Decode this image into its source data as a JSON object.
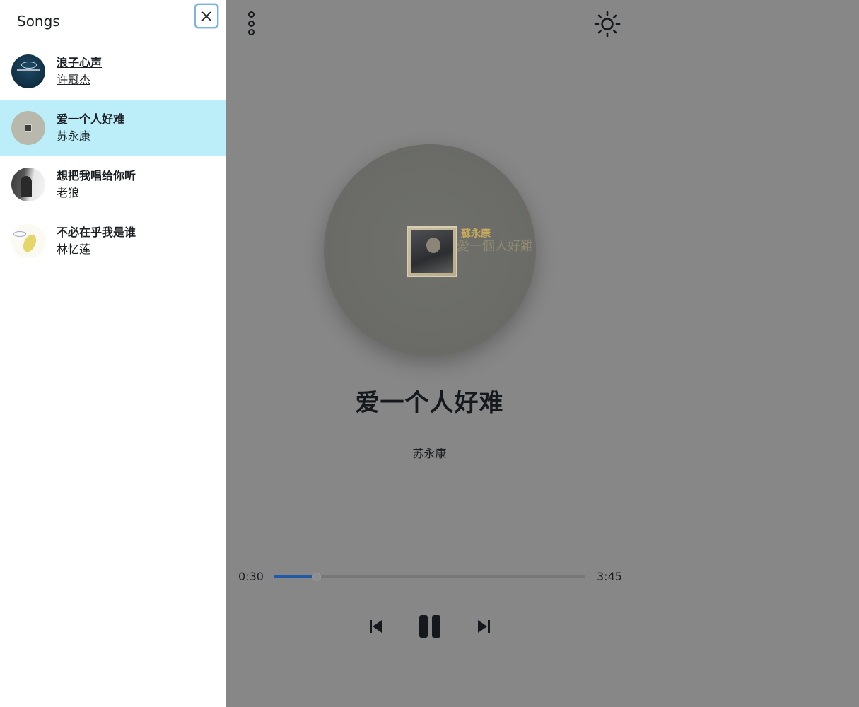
{
  "drawer": {
    "title": "Songs",
    "close_icon": "close-icon",
    "songs": [
      {
        "title": "浪子心声",
        "artist": "许冠杰"
      },
      {
        "title": "爱一个人好难",
        "artist": "苏永康"
      },
      {
        "title": "想把我唱给你听",
        "artist": "老狼"
      },
      {
        "title": "不必在乎我是谁",
        "artist": "林忆莲"
      }
    ]
  },
  "player": {
    "menu_icon": "more-vertical-icon",
    "theme_icon": "sun-icon",
    "now_playing": {
      "title": "爱一个人好难",
      "artist": "苏永康",
      "cover_text_line1": "蘇永康",
      "cover_text_line2": "愛一個人好難"
    },
    "time_current": "0:30",
    "time_total": "3:45",
    "progress_fraction": 0.133,
    "controls": {
      "prev_icon": "skip-previous-icon",
      "pause_icon": "pause-icon",
      "next_icon": "skip-next-icon"
    }
  },
  "colors": {
    "overlay": "#878787",
    "active_row": "#bbeef8",
    "progress_fill": "#1f5aa6",
    "focus_ring": "#7fb2e0"
  }
}
